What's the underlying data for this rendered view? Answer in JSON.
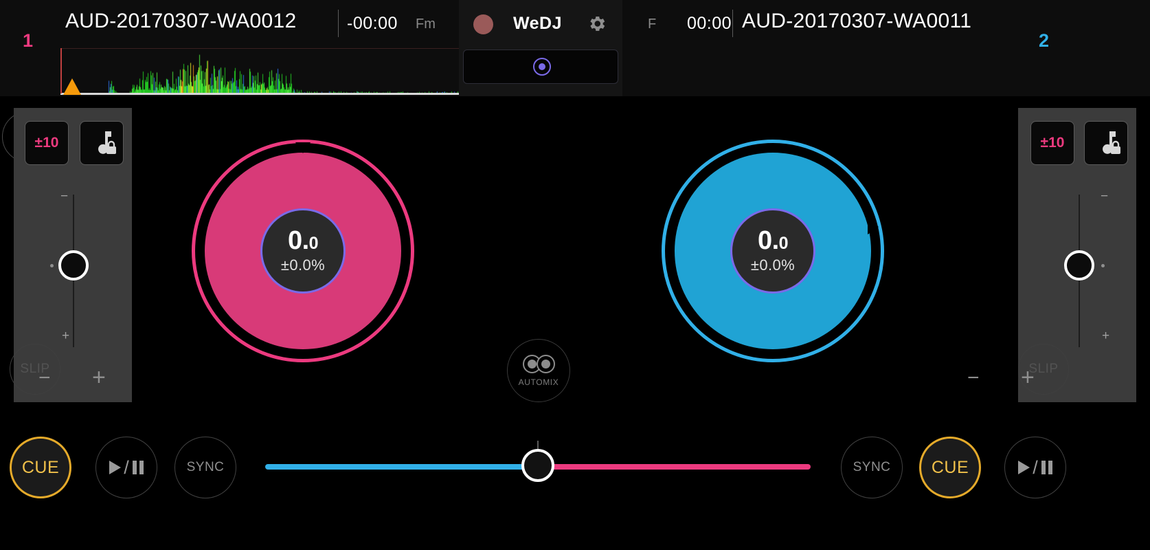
{
  "app": {
    "name": "WeDJ",
    "accent_pink": "#ec3a7f",
    "accent_blue": "#31b0e8",
    "accent_gold": "#e5aa2a",
    "accent_purple": "#7a6ae8"
  },
  "header": {
    "brand": "WeDJ",
    "record_icon": "record-dot-icon",
    "settings_icon": "gear-icon",
    "mix_icon": "target-circle-icon"
  },
  "decks": [
    {
      "number": "1",
      "track_title": "AUD-20170307-WA0012",
      "time": "-00:00",
      "time_mode": "Fm",
      "bpm": "0.",
      "bpm_decimal": "0",
      "tempo_pct": "±0.0%",
      "range_label": "±10",
      "keylock_icon": "music-note-lock-icon",
      "slip_label": "SLIP",
      "tempo_minus": "−",
      "tempo_plus": "+",
      "cue_label": "CUE",
      "sync_label": "SYNC",
      "play_label": "play-pause-icon",
      "color": "#ec3a7f"
    },
    {
      "number": "2",
      "track_title": "AUD-20170307-WA0011",
      "time": "00:00",
      "time_mode": "F",
      "bpm": "0.",
      "bpm_decimal": "0",
      "tempo_pct": "±0.0%",
      "range_label": "±10",
      "keylock_icon": "music-note-lock-icon",
      "slip_label": "SLIP",
      "tempo_minus": "−",
      "tempo_plus": "+",
      "cue_label": "CUE",
      "sync_label": "SYNC",
      "play_label": "play-pause-icon",
      "color": "#31b0e8"
    }
  ],
  "automix": {
    "label": "AUTOMIX",
    "icon": "two-circles-icon"
  },
  "crossfader": {
    "left_color": "#31b0e8",
    "right_color": "#ec3a7f",
    "position_pct": 50
  }
}
